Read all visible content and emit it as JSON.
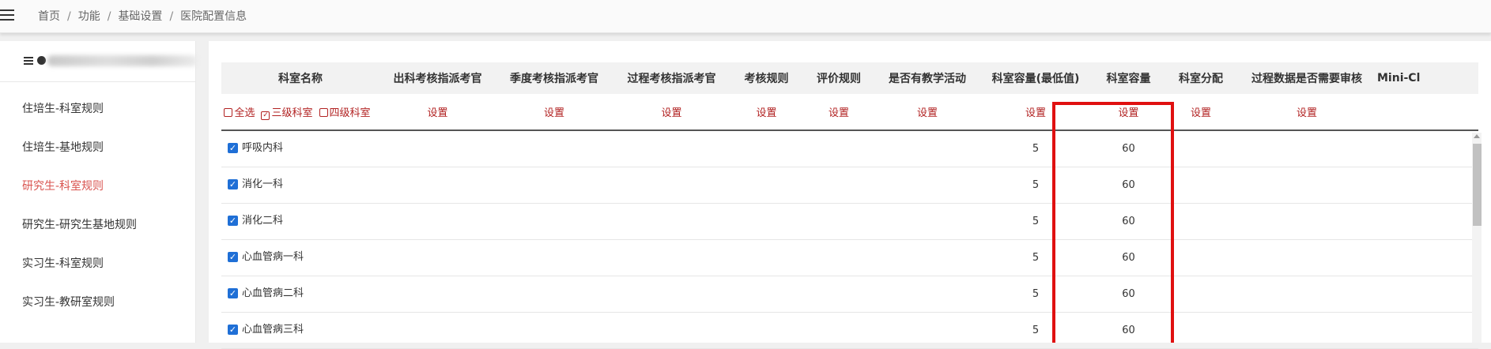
{
  "breadcrumb": [
    "首页",
    "功能",
    "基础设置",
    "医院配置信息"
  ],
  "breadcrumb_sep": "/",
  "sidebar": {
    "items": [
      {
        "label": "住培生-科室规则",
        "active": false
      },
      {
        "label": "住培生-基地规则",
        "active": false
      },
      {
        "label": "研究生-科室规则",
        "active": true
      },
      {
        "label": "研究生-研究生基地规则",
        "active": false
      },
      {
        "label": "实习生-科室规则",
        "active": false
      },
      {
        "label": "实习生-教研室规则",
        "active": false
      }
    ]
  },
  "table": {
    "columns": [
      "科室名称",
      "出科考核指派考官",
      "季度考核指派考官",
      "过程考核指派考官",
      "考核规则",
      "评价规则",
      "是否有教学活动",
      "科室容量(最低值)",
      "科室容量",
      "科室分配",
      "过程数据是否需要审核",
      "Mini-Cl"
    ],
    "filters": [
      {
        "label": "全选",
        "checked": false
      },
      {
        "label": "三级科室",
        "checked": true
      },
      {
        "label": "四级科室",
        "checked": false
      }
    ],
    "set_label": "设置",
    "rows": [
      {
        "name": "呼吸内科",
        "min_capacity": "5",
        "capacity": "60"
      },
      {
        "name": "消化一科",
        "min_capacity": "5",
        "capacity": "60"
      },
      {
        "name": "消化二科",
        "min_capacity": "5",
        "capacity": "60"
      },
      {
        "name": "心血管病一科",
        "min_capacity": "5",
        "capacity": "60"
      },
      {
        "name": "心血管病二科",
        "min_capacity": "5",
        "capacity": "60"
      },
      {
        "name": "心血管病三科",
        "min_capacity": "5",
        "capacity": "60"
      }
    ]
  },
  "colors": {
    "accent_red": "#b22222",
    "highlight_box": "#e01010",
    "checkbox_blue": "#1f6fd6",
    "active_menu": "#d9534f"
  },
  "icons": [
    "menu-icon",
    "list-icon",
    "checkbox-checked-icon",
    "checkbox-empty-icon"
  ]
}
